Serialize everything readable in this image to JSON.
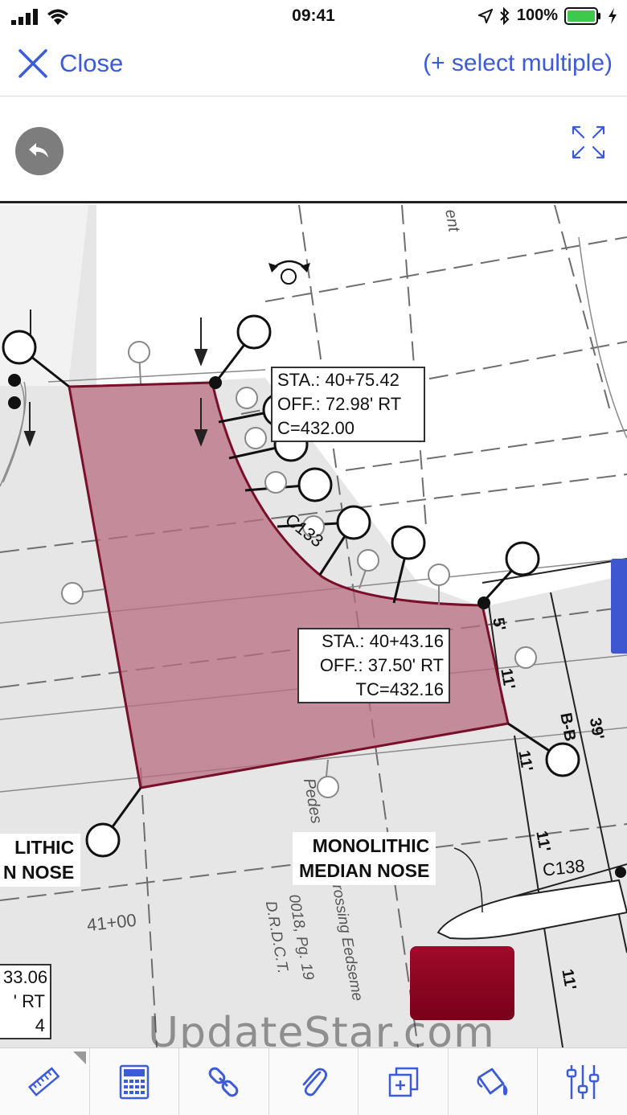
{
  "status": {
    "time": "09:41",
    "battery": "100%"
  },
  "nav": {
    "close_label": "Close",
    "select_multiple_label": "(+ select multiple)"
  },
  "drawing": {
    "label_top": {
      "line1": "STA.: 40+75.42",
      "line2": "OFF.: 72.98' RT",
      "line3": "C=432.00"
    },
    "label_mid": {
      "line1": "STA.: 40+43.16",
      "line2": "OFF.: 37.50' RT",
      "line3": "TC=432.16"
    },
    "label_bottom_left": {
      "line1": "33.06",
      "line2": "' RT",
      "line3": "4"
    },
    "callout_left": {
      "line1": "LITHIC",
      "line2": "N NOSE"
    },
    "callout_right": {
      "line1": "MONOLITHIC",
      "line2": "MEDIAN NOSE"
    },
    "plan_labels": {
      "curve": "C133",
      "station": "41+00",
      "c138": "C138",
      "dim_5": "5'",
      "dim_11a": "11'",
      "dim_11b": "11'",
      "dim_11c": "11'",
      "dim_11d": "11'",
      "dim_39": "39'",
      "bb": "B-B",
      "ent": "ent",
      "pedes": "Pedes",
      "crossing1": "Crossing Eedseme",
      "crossing2": "0018, Pg. 19",
      "crossing3": "D.R.D.C.T."
    },
    "watermark": "UpdateStar.com",
    "fill_color": "#b86e80",
    "stroke_color": "#7a0f2a"
  },
  "toolbar": {
    "tools": [
      {
        "name": "ruler-icon"
      },
      {
        "name": "calculator-icon"
      },
      {
        "name": "link-icon"
      },
      {
        "name": "paperclip-icon"
      },
      {
        "name": "duplicate-icon"
      },
      {
        "name": "paint-bucket-icon"
      },
      {
        "name": "sliders-icon"
      }
    ]
  }
}
